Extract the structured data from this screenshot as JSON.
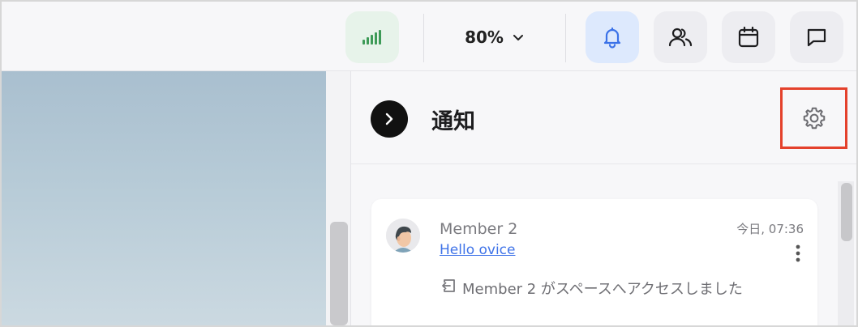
{
  "topbar": {
    "signal_icon": "signal-bars-icon",
    "zoom_value": "80%",
    "zoom_icon": "chevron-down-icon",
    "buttons": [
      "bell-icon",
      "members-icon",
      "calendar-icon",
      "chat-icon"
    ]
  },
  "notifications": {
    "title": "通知",
    "collapse_icon": "chevron-right-icon",
    "settings_icon": "gear-icon",
    "items": [
      {
        "sender": "Member 2",
        "space_link": "Hello ovice",
        "time": "今日, 07:36",
        "message": "Member 2 がスペースへアクセスしました",
        "message_icon": "enter-icon"
      }
    ]
  },
  "colors": {
    "signal_green": "#3d9a57",
    "bell_blue": "#3b72e8",
    "highlight_red": "#e4412c",
    "link_blue": "#3f73e8"
  }
}
